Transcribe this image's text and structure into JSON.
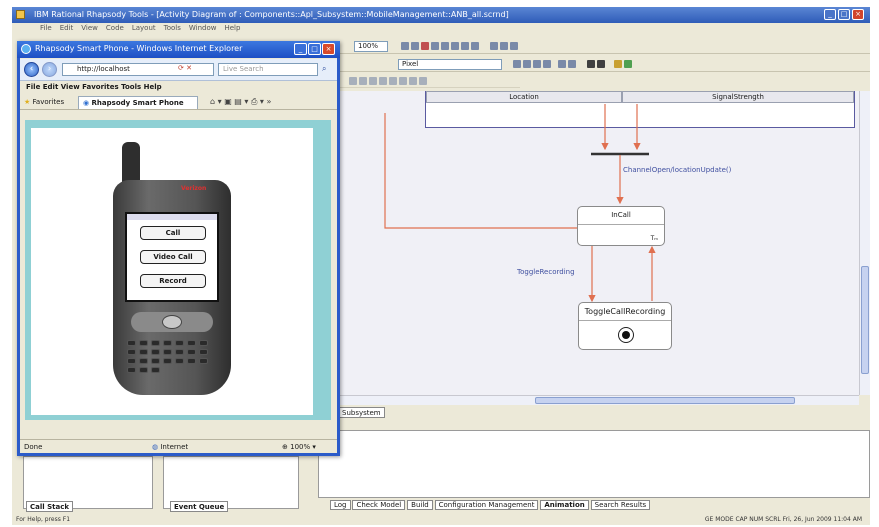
{
  "window": {
    "title": "IBM Rational Rhapsody Tools - [Activity Diagram of : Components::Apl_Subsystem::MobileManagement::ANB_all.scrnd]"
  },
  "menu": [
    "File",
    "Edit",
    "View",
    "Code",
    "Layout",
    "Tools",
    "Window",
    "Help"
  ],
  "toolbar": {
    "zoom": "100%",
    "font_combo": "Pixel"
  },
  "diagram": {
    "columns": [
      "Location",
      "SignalStrength"
    ],
    "event_channel": "ChannelOpen/locationUpdate()",
    "event_toggle": "ToggleRecording",
    "state_incall": {
      "name": "InCall",
      "marker": "Tₘ"
    },
    "state_toggle": {
      "name": "ToggleCallRecording"
    }
  },
  "diagram_tabs": [
    "Subsystem"
  ],
  "ie": {
    "title": "Rhapsody Smart Phone - Windows Internet Explorer",
    "address": "http://localhost",
    "search_placeholder": "Live Search",
    "menu": [
      "File",
      "Edit",
      "View",
      "Favorites",
      "Tools",
      "Help"
    ],
    "favorites": "Favorites",
    "tab": "Rhapsody Smart Phone",
    "status_done": "Done",
    "status_zone": "Internet",
    "status_zoom": "100%"
  },
  "phone": {
    "brand": "Verizon",
    "buttons": [
      "Call",
      "Video Call",
      "Record"
    ]
  },
  "bottom_panels": {
    "call_stack": "Call Stack",
    "event_queue": "Event Queue"
  },
  "output_tabs": [
    "Log",
    "Check Model",
    "Build",
    "Configuration Management",
    "Animation",
    "Search Results"
  ],
  "statusbar": {
    "help": "For Help, press F1",
    "right": "GE MODE  CAP  NUM  SCRL  Fri, 26, Jun 2009  11:04 AM"
  },
  "colors": {
    "title": "#2f5cb8",
    "flow": "#e07050",
    "event_text": "#4050a0",
    "toolbar": "#ece9d8"
  }
}
